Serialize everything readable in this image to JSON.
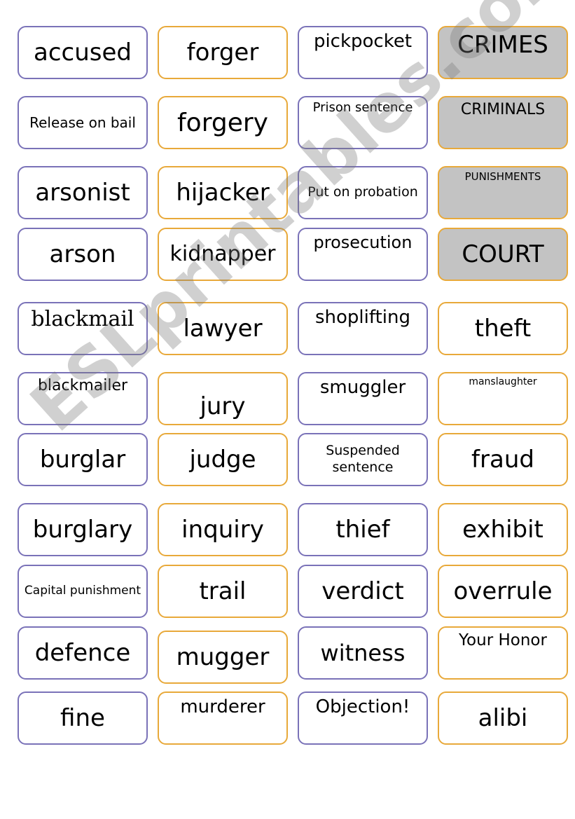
{
  "colors": {
    "purple_border": "#7a72b8",
    "orange_border": "#e8a93a",
    "header_fill": "#c3c3c3"
  },
  "watermark": "ESLprintables.com",
  "rows": [
    [
      "accused",
      "forger",
      "pickpocket",
      "CRIMES"
    ],
    [
      "Release on bail",
      "forgery",
      "Prison sentence",
      "CRIMINALS"
    ],
    [
      "arsonist",
      "hijacker",
      "Put on probation",
      "PUNISHMENTS"
    ],
    [
      "arson",
      "kidnapper",
      "prosecution",
      "COURT"
    ],
    [
      "blackmail",
      "lawyer",
      "shoplifting",
      "theft"
    ],
    [
      "blackmailer",
      "jury",
      "smuggler",
      "manslaughter"
    ],
    [
      "burglar",
      "judge",
      "Suspended sentence",
      "fraud"
    ],
    [
      "burglary",
      "inquiry",
      "thief",
      "exhibit"
    ],
    [
      "Capital punishment",
      "trail",
      "verdict",
      "overrule"
    ],
    [
      "defence",
      "mugger",
      "witness",
      "Your Honor"
    ],
    [
      "fine",
      "murderer",
      "Objection!",
      "alibi"
    ]
  ]
}
